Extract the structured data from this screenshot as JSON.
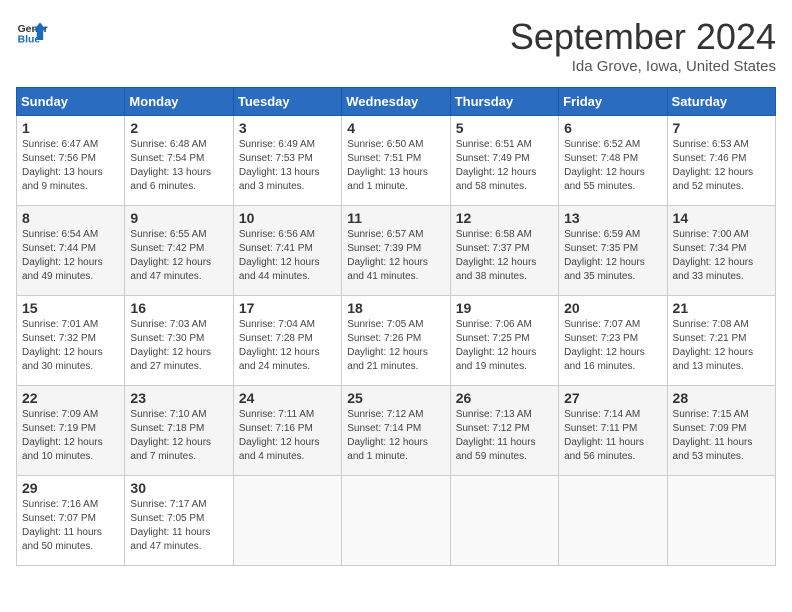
{
  "logo": {
    "line1": "General",
    "line2": "Blue"
  },
  "title": "September 2024",
  "location": "Ida Grove, Iowa, United States",
  "headers": [
    "Sunday",
    "Monday",
    "Tuesday",
    "Wednesday",
    "Thursday",
    "Friday",
    "Saturday"
  ],
  "weeks": [
    [
      {
        "day": "1",
        "sunrise": "6:47 AM",
        "sunset": "7:56 PM",
        "daylight": "13 hours and 9 minutes."
      },
      {
        "day": "2",
        "sunrise": "6:48 AM",
        "sunset": "7:54 PM",
        "daylight": "13 hours and 6 minutes."
      },
      {
        "day": "3",
        "sunrise": "6:49 AM",
        "sunset": "7:53 PM",
        "daylight": "13 hours and 3 minutes."
      },
      {
        "day": "4",
        "sunrise": "6:50 AM",
        "sunset": "7:51 PM",
        "daylight": "13 hours and 1 minute."
      },
      {
        "day": "5",
        "sunrise": "6:51 AM",
        "sunset": "7:49 PM",
        "daylight": "12 hours and 58 minutes."
      },
      {
        "day": "6",
        "sunrise": "6:52 AM",
        "sunset": "7:48 PM",
        "daylight": "12 hours and 55 minutes."
      },
      {
        "day": "7",
        "sunrise": "6:53 AM",
        "sunset": "7:46 PM",
        "daylight": "12 hours and 52 minutes."
      }
    ],
    [
      {
        "day": "8",
        "sunrise": "6:54 AM",
        "sunset": "7:44 PM",
        "daylight": "12 hours and 49 minutes."
      },
      {
        "day": "9",
        "sunrise": "6:55 AM",
        "sunset": "7:42 PM",
        "daylight": "12 hours and 47 minutes."
      },
      {
        "day": "10",
        "sunrise": "6:56 AM",
        "sunset": "7:41 PM",
        "daylight": "12 hours and 44 minutes."
      },
      {
        "day": "11",
        "sunrise": "6:57 AM",
        "sunset": "7:39 PM",
        "daylight": "12 hours and 41 minutes."
      },
      {
        "day": "12",
        "sunrise": "6:58 AM",
        "sunset": "7:37 PM",
        "daylight": "12 hours and 38 minutes."
      },
      {
        "day": "13",
        "sunrise": "6:59 AM",
        "sunset": "7:35 PM",
        "daylight": "12 hours and 35 minutes."
      },
      {
        "day": "14",
        "sunrise": "7:00 AM",
        "sunset": "7:34 PM",
        "daylight": "12 hours and 33 minutes."
      }
    ],
    [
      {
        "day": "15",
        "sunrise": "7:01 AM",
        "sunset": "7:32 PM",
        "daylight": "12 hours and 30 minutes."
      },
      {
        "day": "16",
        "sunrise": "7:03 AM",
        "sunset": "7:30 PM",
        "daylight": "12 hours and 27 minutes."
      },
      {
        "day": "17",
        "sunrise": "7:04 AM",
        "sunset": "7:28 PM",
        "daylight": "12 hours and 24 minutes."
      },
      {
        "day": "18",
        "sunrise": "7:05 AM",
        "sunset": "7:26 PM",
        "daylight": "12 hours and 21 minutes."
      },
      {
        "day": "19",
        "sunrise": "7:06 AM",
        "sunset": "7:25 PM",
        "daylight": "12 hours and 19 minutes."
      },
      {
        "day": "20",
        "sunrise": "7:07 AM",
        "sunset": "7:23 PM",
        "daylight": "12 hours and 16 minutes."
      },
      {
        "day": "21",
        "sunrise": "7:08 AM",
        "sunset": "7:21 PM",
        "daylight": "12 hours and 13 minutes."
      }
    ],
    [
      {
        "day": "22",
        "sunrise": "7:09 AM",
        "sunset": "7:19 PM",
        "daylight": "12 hours and 10 minutes."
      },
      {
        "day": "23",
        "sunrise": "7:10 AM",
        "sunset": "7:18 PM",
        "daylight": "12 hours and 7 minutes."
      },
      {
        "day": "24",
        "sunrise": "7:11 AM",
        "sunset": "7:16 PM",
        "daylight": "12 hours and 4 minutes."
      },
      {
        "day": "25",
        "sunrise": "7:12 AM",
        "sunset": "7:14 PM",
        "daylight": "12 hours and 1 minute."
      },
      {
        "day": "26",
        "sunrise": "7:13 AM",
        "sunset": "7:12 PM",
        "daylight": "11 hours and 59 minutes."
      },
      {
        "day": "27",
        "sunrise": "7:14 AM",
        "sunset": "7:11 PM",
        "daylight": "11 hours and 56 minutes."
      },
      {
        "day": "28",
        "sunrise": "7:15 AM",
        "sunset": "7:09 PM",
        "daylight": "11 hours and 53 minutes."
      }
    ],
    [
      {
        "day": "29",
        "sunrise": "7:16 AM",
        "sunset": "7:07 PM",
        "daylight": "11 hours and 50 minutes."
      },
      {
        "day": "30",
        "sunrise": "7:17 AM",
        "sunset": "7:05 PM",
        "daylight": "11 hours and 47 minutes."
      },
      null,
      null,
      null,
      null,
      null
    ]
  ],
  "labels": {
    "sunrise": "Sunrise:",
    "sunset": "Sunset:",
    "daylight": "Daylight:"
  }
}
